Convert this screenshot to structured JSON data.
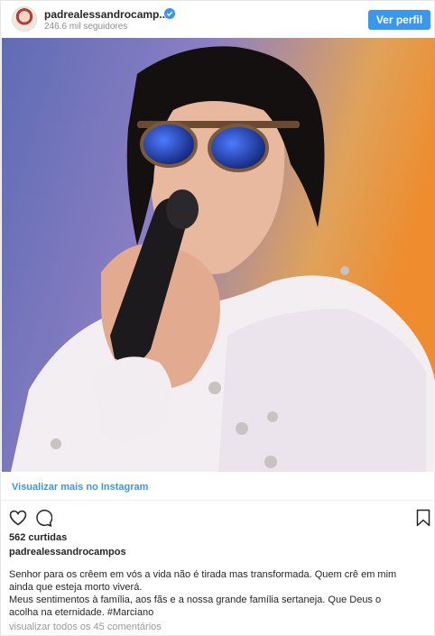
{
  "header": {
    "username": "padrealessandrocamp...",
    "followers": "246.6 mil seguidores",
    "view_profile_label": "Ver perfil"
  },
  "link": {
    "more_label": "Visualizar mais no Instagram"
  },
  "post": {
    "likes": "562 curtidas",
    "caption_user": "padrealessandrocampos",
    "caption_lines": [
      "Senhor para os crêem em vós a vida não é tirada mas transformada. Quem crê em mim",
      "ainda que esteja morto viverá.",
      "Meus sentimentos à família, aos fãs e a nossa grande família sertaneja. Que Deus o",
      "acolha na eternidade. #Marciano"
    ],
    "comments_link": "visualizar todos os 45 comentários"
  },
  "icons": {
    "verified": "verified-badge-icon",
    "like": "heart-icon",
    "comment": "comment-icon",
    "save": "bookmark-icon"
  },
  "colors": {
    "accent": "#3897f0",
    "text": "#262626",
    "muted": "#8e8e8e"
  }
}
